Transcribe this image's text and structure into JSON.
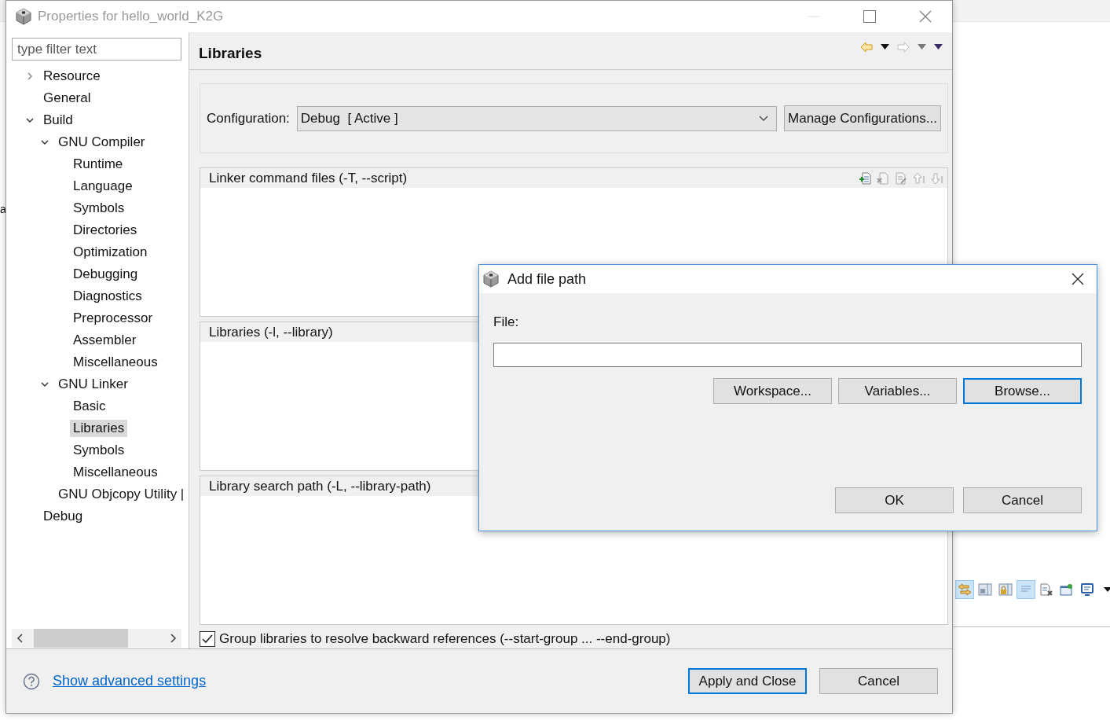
{
  "background_app": {
    "text_fragment": "a",
    "toolbar": [
      {
        "kind": "sync",
        "selected": true
      },
      {
        "kind": "save-layout",
        "selected": false
      },
      {
        "kind": "lock-layout",
        "selected": false
      },
      {
        "kind": "lines",
        "selected": true
      },
      {
        "kind": "doc-remove",
        "selected": false
      },
      {
        "kind": "pin",
        "selected": false
      },
      {
        "kind": "monitor",
        "selected": false
      },
      {
        "kind": "dropdown",
        "selected": false
      }
    ]
  },
  "window": {
    "title": "Properties for hello_world_K2G"
  },
  "filter": {
    "placeholder": "type filter text"
  },
  "tree": [
    {
      "label": "Resource",
      "expanded": false,
      "selected": false
    },
    {
      "label": "General",
      "selected": false
    },
    {
      "label": "Build",
      "expanded": true,
      "selected": false,
      "children": [
        {
          "label": "GNU Compiler",
          "expanded": true,
          "selected": false,
          "children": [
            {
              "label": "Runtime",
              "selected": false
            },
            {
              "label": "Language",
              "selected": false
            },
            {
              "label": "Symbols",
              "selected": false
            },
            {
              "label": "Directories",
              "selected": false
            },
            {
              "label": "Optimization",
              "selected": false
            },
            {
              "label": "Debugging",
              "selected": false
            },
            {
              "label": "Diagnostics",
              "selected": false
            },
            {
              "label": "Preprocessor",
              "selected": false
            },
            {
              "label": "Assembler",
              "selected": false
            },
            {
              "label": "Miscellaneous",
              "selected": false
            }
          ]
        },
        {
          "label": "GNU Linker",
          "expanded": true,
          "selected": false,
          "children": [
            {
              "label": "Basic",
              "selected": false
            },
            {
              "label": "Libraries",
              "selected": true
            },
            {
              "label": "Symbols",
              "selected": false
            },
            {
              "label": "Miscellaneous",
              "selected": false
            }
          ]
        },
        {
          "label": "GNU Objcopy Utility  |",
          "selected": false
        }
      ]
    },
    {
      "label": "Debug",
      "selected": false
    }
  ],
  "page": {
    "title": "Libraries",
    "nav": [
      {
        "kind": "back",
        "disabled": false
      },
      {
        "kind": "forward",
        "disabled": true
      }
    ]
  },
  "configuration": {
    "label": "Configuration:",
    "value": "Debug  [ Active ]",
    "manage_button": "Manage Configurations..."
  },
  "sections": [
    {
      "title": "Linker command files (-T, --script)",
      "tools": [
        {
          "kind": "add",
          "disabled": false
        },
        {
          "kind": "delete",
          "disabled": true
        },
        {
          "kind": "edit",
          "disabled": true
        },
        {
          "kind": "up",
          "disabled": true
        },
        {
          "kind": "down",
          "disabled": true
        }
      ]
    },
    {
      "title": "Libraries (-l, --library)"
    },
    {
      "title": "Library search path (-L, --library-path)"
    }
  ],
  "group_libraries": {
    "label": "Group libraries to resolve backward references (--start-group ... --end-group)",
    "checked": true
  },
  "footer": {
    "link": "Show advanced settings",
    "buttons": [
      {
        "label": "Apply and Close",
        "default": true
      },
      {
        "label": "Cancel",
        "default": false
      }
    ]
  },
  "dialog": {
    "title": "Add file path",
    "field_label": "File:",
    "buttons": [
      {
        "label": "Workspace...",
        "focused": false
      },
      {
        "label": "Variables...",
        "focused": false
      },
      {
        "label": "Browse...",
        "focused": true
      }
    ],
    "actions": [
      "OK",
      "Cancel"
    ]
  }
}
